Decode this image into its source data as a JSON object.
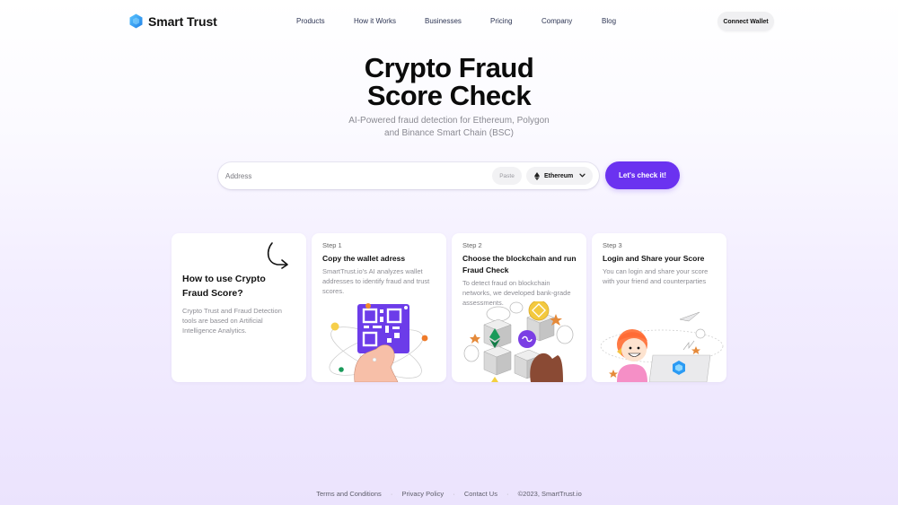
{
  "header": {
    "brand": "Smart Trust",
    "nav": [
      "Products",
      "How it Works",
      "Businesses",
      "Pricing",
      "Company",
      "Blog"
    ],
    "connect_wallet": "Connect Wallet"
  },
  "hero": {
    "title_line1": "Crypto Fraud",
    "title_line2": "Score Check",
    "subtitle_line1": "AI-Powered fraud detection for Ethereum, Polygon",
    "subtitle_line2": "and Binance Smart Chain (BSC)"
  },
  "search": {
    "address_placeholder": "Address",
    "address_value": "",
    "paste_label": "Paste",
    "chain_selected": "Ethereum",
    "submit_label": "Let's check it!"
  },
  "cards": {
    "intro": {
      "title": "How to use Crypto Fraud Score?",
      "description": "Crypto Trust and Fraud Detection tools are based on Artificial Intelligence Analytics."
    },
    "steps": [
      {
        "step": "Step 1",
        "title": "Copy the wallet adress",
        "description": "SmartTrust.io's AI analyzes wallet addresses to identify fraud and trust scores."
      },
      {
        "step": "Step 2",
        "title": "Choose the blockchain and run Fraud Check",
        "description": "To detect fraud on blockchain networks, we developed bank-grade assessments."
      },
      {
        "step": "Step 3",
        "title": "Login and Share your Score",
        "description": "You can login and share your score with your friend and counterparties"
      }
    ]
  },
  "footer": {
    "links": [
      "Terms and Conditions",
      "Privacy Policy",
      "Contact Us"
    ],
    "copyright": "©2023, SmartTrust.io"
  },
  "colors": {
    "accent": "#6b32f0",
    "brand_logo": "#2b9bf4",
    "qr_purple": "#6c3ce9"
  }
}
